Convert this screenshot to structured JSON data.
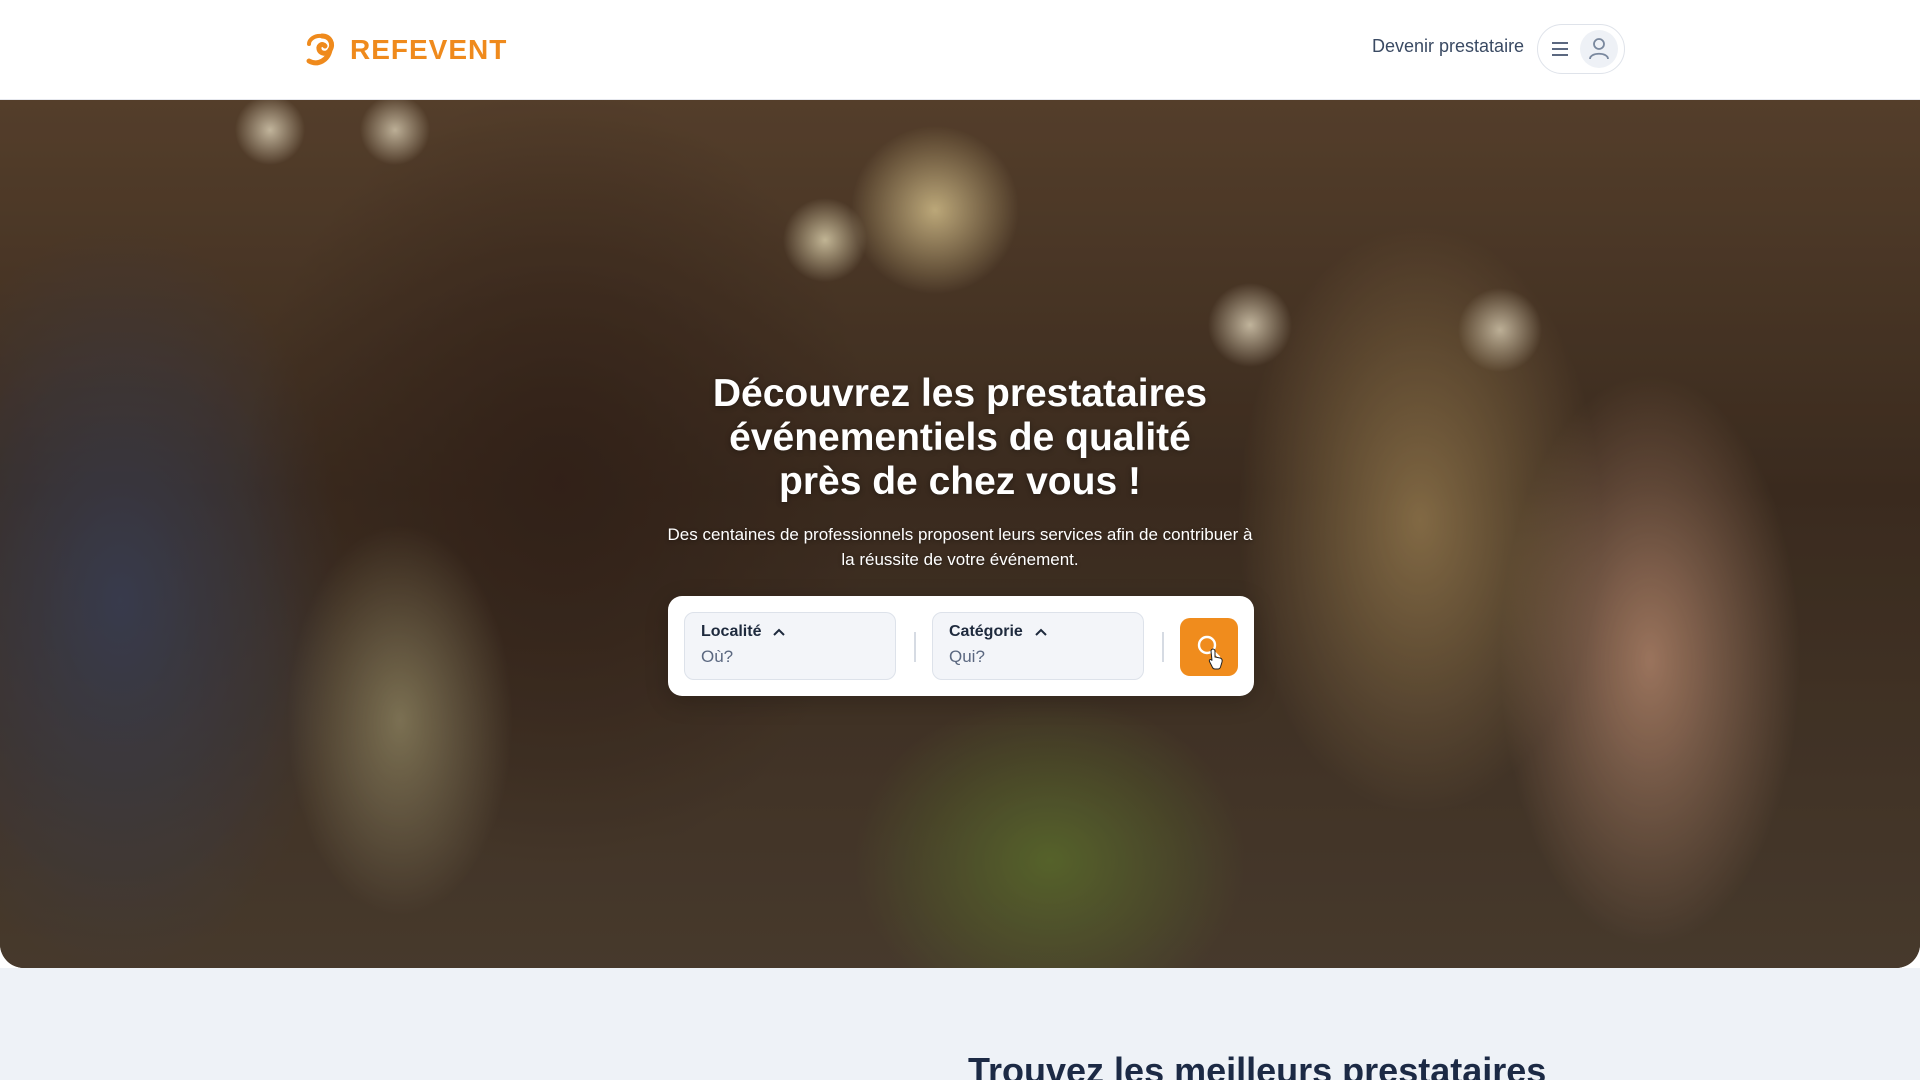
{
  "header": {
    "logo_text": "REFEVENT",
    "become_provider_label": "Devenir prestataire",
    "menu_icon": "hamburger-icon",
    "avatar_icon": "user-icon",
    "brand_color": "#ef8a1c"
  },
  "hero": {
    "title_lines": [
      "Découvrez les prestataires",
      "événementiels de qualité",
      "près de chez vous !"
    ],
    "subtitle_lines": [
      "Des centaines de professionnels proposent leurs services afin de contribuer à",
      "la réussite de votre événement."
    ]
  },
  "search": {
    "location": {
      "label": "Localité",
      "placeholder": "Où?"
    },
    "category": {
      "label": "Catégorie",
      "placeholder": "Qui?"
    },
    "button_icon": "search-icon",
    "button_color": "#f08c1d"
  },
  "section": {
    "heading": "Trouvez les meilleurs prestataires"
  }
}
